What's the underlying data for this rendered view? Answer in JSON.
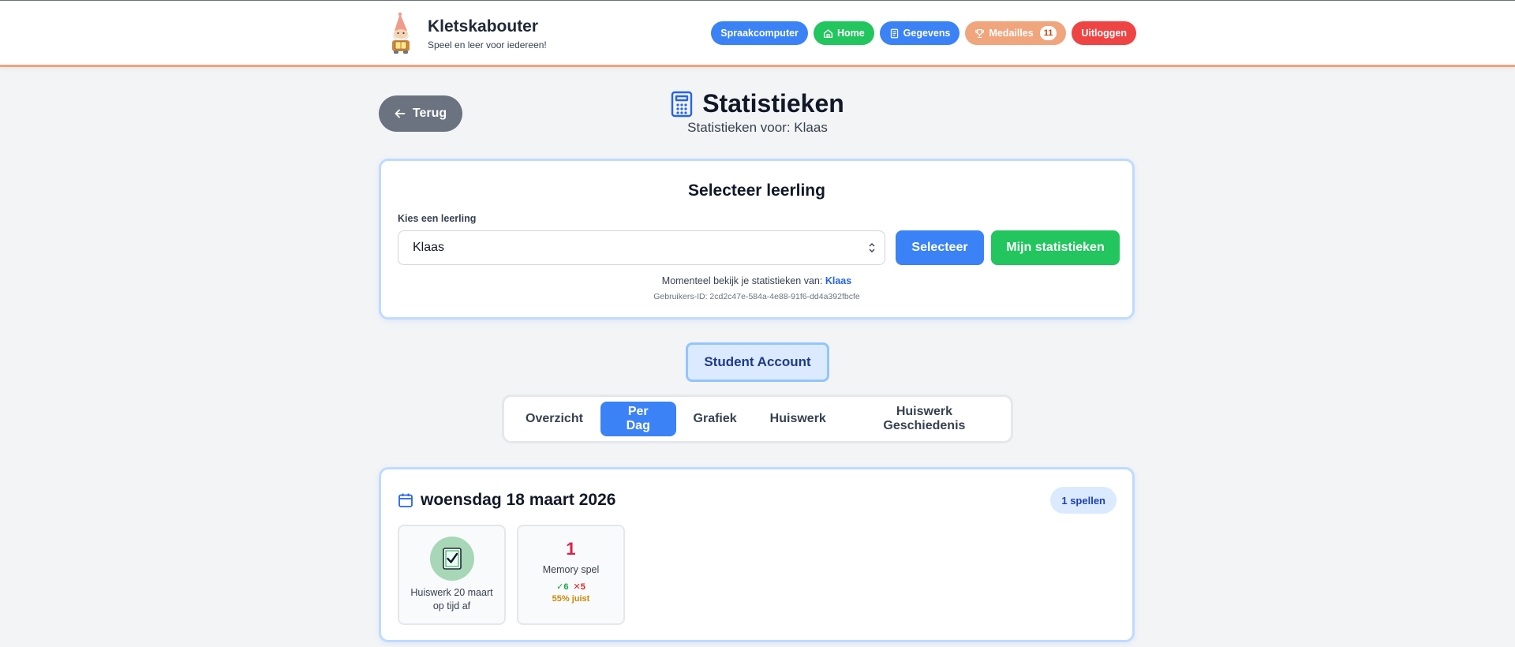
{
  "header": {
    "brand_title": "Kletskabouter",
    "brand_subtitle": "Speel en leer voor iedereen!",
    "nav": {
      "speech": "Spraakcomputer",
      "home": "Home",
      "data": "Gegevens",
      "medals": "Medailles",
      "medals_count": "11",
      "logout": "Uitloggen"
    }
  },
  "page": {
    "back_label": "Terug",
    "title": "Statistieken",
    "subtitle": "Statistieken voor: Klaas"
  },
  "selector": {
    "title": "Selecteer leerling",
    "label": "Kies een leerling",
    "selected_value": "Klaas",
    "select_button": "Selecteer",
    "mine_button": "Mijn statistieken",
    "current_prefix": "Momenteel bekijk je statistieken van:",
    "current_name": "Klaas",
    "user_id_line": "Gebruikers-ID: 2cd2c47e-584a-4e88-91f6-dd4a392fbcfe"
  },
  "account_badge": "Student Account",
  "tabs": [
    {
      "label": "Overzicht",
      "active": false
    },
    {
      "label": "Per Dag",
      "active": true
    },
    {
      "label": "Grafiek",
      "active": false
    },
    {
      "label": "Huiswerk",
      "active": false
    },
    {
      "label": "Huiswerk Geschiedenis",
      "active": false
    }
  ],
  "day": {
    "date": "woensdag 18 maart 2026",
    "games_badge": "1 spellen",
    "homework_tile": {
      "icon": "checked-document-icon",
      "label": "Huiswerk 20 maart op tijd af"
    },
    "memory_tile": {
      "count": "1",
      "label": "Memory spel",
      "correct": "✓6",
      "wrong": "✕5",
      "percent": "55% juist"
    }
  },
  "colors": {
    "primary": "#3b82f6",
    "success": "#22c55e",
    "danger": "#ef4444",
    "medals": "#f0a57d",
    "back": "#6b7280",
    "card_border": "#bfdbfe"
  }
}
